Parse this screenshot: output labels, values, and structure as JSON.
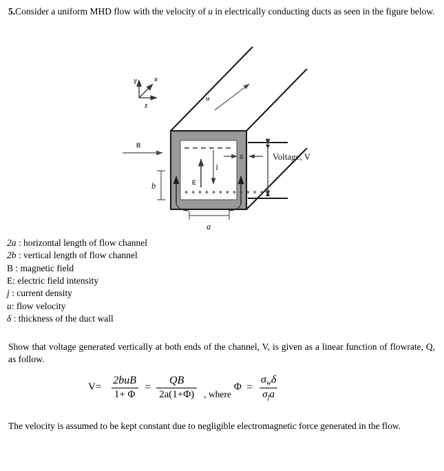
{
  "document": {
    "question_number": "5.",
    "intro": {
      "before_u": "Consider a uniform MHD flow with the velocity of ",
      "u_symbol": "u",
      "after_u": " in electrically conducting ducts as seen in the figure below."
    },
    "legend": [
      {
        "symbol": "2a",
        "symbol_italic": true,
        "separator": " : ",
        "text": "horizontal length of flow channel"
      },
      {
        "symbol": "2b",
        "symbol_italic": true,
        "separator": " : ",
        "text": "vertical length of flow channel"
      },
      {
        "symbol": "B",
        "symbol_italic": false,
        "separator": " : ",
        "text": "magnetic field"
      },
      {
        "symbol": "E",
        "symbol_italic": false,
        "separator": ": ",
        "text": "electric field intensity"
      },
      {
        "symbol": "j",
        "symbol_italic": true,
        "separator": " : ",
        "text": "current density"
      },
      {
        "symbol": "u",
        "symbol_italic": true,
        "separator": ": ",
        "text": "flow velocity"
      },
      {
        "symbol": "δ",
        "symbol_italic": true,
        "separator": " :  ",
        "text": "thickness of the duct wall"
      }
    ],
    "show_paragraph": "Show that voltage generated vertically at both ends of the channel, V, is given as a linear function of flowrate, Q, as follow.",
    "closing_paragraph": "The velocity is assumed to be kept constant due to negligible electromagnetic force generated in the flow.",
    "equation": {
      "lead": "V=",
      "frac1_numerator": "2buB",
      "frac1_denominator": "1+ Φ",
      "equals": "=",
      "frac2_numerator": "QB",
      "frac2_denominator": "2a(1+Φ)",
      "where_text": ", where",
      "phi_symbol": "Φ",
      "phi_equals": "=",
      "frac3_numerator_sigma": "σ",
      "frac3_numerator_sub": "w",
      "frac3_numerator_delta": "δ",
      "frac3_denominator_sigma": "σ",
      "frac3_denominator_sub": "f",
      "frac3_denominator_a": "a"
    }
  },
  "figure": {
    "name": "mhd-duct-cross-section-diagram",
    "axes": {
      "y": "y",
      "x": "x",
      "z": "z"
    },
    "labels": {
      "magnetic_field": "B",
      "vertical_dimension": "b",
      "horizontal_dimension": "a",
      "electric_field": "E",
      "current_density": "j",
      "wall_thickness": "δ",
      "velocity": "u",
      "voltage": "Voltage, V",
      "charge_positive_row": "+ + + + + + + + + + + +"
    },
    "colors": {
      "duct_wall_fill": "#9a9a9a",
      "duct_outline": "#1a1a1a",
      "channel_fill": "#ffffff",
      "arrow_color": "#4a4a58",
      "label_color": "#3b3b4a"
    }
  }
}
